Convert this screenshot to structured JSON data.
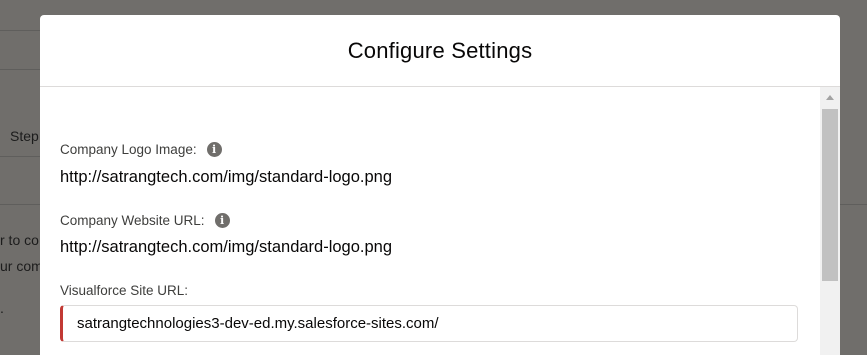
{
  "background": {
    "step_text": "Step",
    "fragment_1": "r to co",
    "fragment_2": "ur com",
    "fragment_3": "."
  },
  "modal": {
    "title": "Configure Settings",
    "fields": {
      "logo": {
        "label": "Company Logo Image:",
        "value": "http://satrangtech.com/img/standard-logo.png",
        "icon": "info-icon"
      },
      "website": {
        "label": "Company Website URL:",
        "value": "http://satrangtech.com/img/standard-logo.png",
        "icon": "info-icon"
      },
      "vf_site": {
        "label": "Visualforce Site URL:",
        "value": "satrangtechnologies3-dev-ed.my.salesforce-sites.com/"
      }
    }
  },
  "colors": {
    "overlay": "#706e6b",
    "error_accent": "#c23934",
    "modal_bg": "#ffffff"
  }
}
